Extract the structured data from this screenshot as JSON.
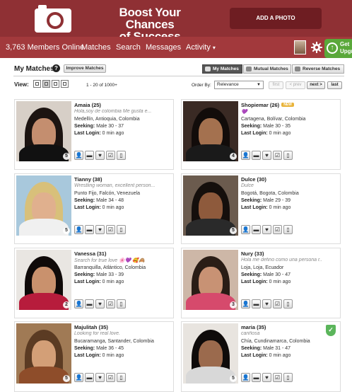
{
  "banner": {
    "headline_line1": "Boost Your Chances",
    "headline_line2": "of Success",
    "add_photo": "ADD A PHOTO"
  },
  "nav": {
    "members_online": "3,763 Members Online",
    "items": [
      "Matches",
      "Search",
      "Messages",
      "Activity"
    ],
    "activity_caret": "▾",
    "upgrade_line1": "Get",
    "upgrade_line2": "Upgr"
  },
  "header": {
    "title": "My Matches",
    "help": "?",
    "improve": "Improve Matches",
    "tabs": [
      "My Matches",
      "Mutual Matches",
      "Reverse Matches"
    ]
  },
  "toolbar": {
    "view_label": "View:",
    "results": "1 - 20 of 1000+",
    "order_label": "Order By:",
    "order_value": "Relevance",
    "pager": [
      "first",
      "< prev",
      "next >",
      "last"
    ]
  },
  "labels": {
    "seeking": "Seeking:",
    "last_login": "Last Login:"
  },
  "profiles": [
    {
      "name": "Amaia (25)",
      "tagline": "Hola,soy de colombia Me gusta e...",
      "location": "Medellín, Antioquia, Colombia",
      "seeking": "Male 30 - 37",
      "last_login": "0 min ago",
      "photos": "5"
    },
    {
      "name": "Shopiemar (26)",
      "badge": "NEW",
      "tagline": "💜",
      "location": "Cartagena, Bolívar, Colombia",
      "seeking": "Male 30 - 35",
      "last_login": "0 min ago",
      "photos": "4"
    },
    {
      "name": "Tianny (38)",
      "tagline": "Wrestling woman, excellent person...",
      "location": "Punto Fijo, Falcón, Venezuela",
      "seeking": "Male 34 - 48",
      "last_login": "0 min ago",
      "photos": "5"
    },
    {
      "name": "Dulce (30)",
      "tagline": "Dulce",
      "location": "Bogotá, Bogota, Colombia",
      "seeking": "Male 29 - 39",
      "last_login": "0 min ago",
      "photos": "5"
    },
    {
      "name": "Vanessa (31)",
      "tagline": "Search for true love 🌸💜 🥰🙈",
      "location": "Barranquilla, Atlántico, Colombia",
      "seeking": "Male 33 - 39",
      "last_login": "0 min ago",
      "photos": "2"
    },
    {
      "name": "Nury (33)",
      "tagline": "Hola me defino como una persona r..",
      "location": "Loja, Loja, Ecuador",
      "seeking": "Male 30 - 47",
      "last_login": "0 min ago",
      "photos": "3"
    },
    {
      "name": "Majulitah (35)",
      "tagline": "Looking for real love.",
      "location": "Bucaramanga, Santander, Colombia",
      "seeking": "Male 36 - 45",
      "last_login": "0 min ago",
      "photos": "5"
    },
    {
      "name": "maria (35)",
      "tagline": "cariñosa",
      "location": "Chía, Cundinamarca, Colombia",
      "seeking": "Male 31 - 47",
      "last_login": "0 min ago",
      "photos": "5"
    }
  ],
  "icons": {
    "action_icons": [
      "add-user-icon",
      "chat-icon",
      "heart-icon",
      "checklist-icon",
      "phone-icon"
    ],
    "photo_count": "camera-icon"
  },
  "colors": {
    "banner": "#8f3034",
    "nav": "#a2393c",
    "upgrade": "#5aa83a",
    "verified": "#5bb55b"
  }
}
